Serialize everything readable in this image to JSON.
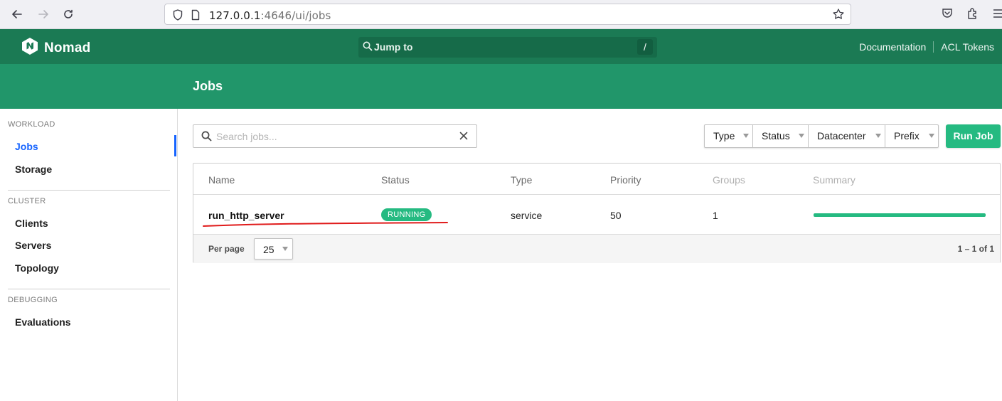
{
  "browser": {
    "url_host": "127.0.0.1",
    "url_rest": ":4646/ui/jobs"
  },
  "header": {
    "brand": "Nomad",
    "jump_to": "Jump to",
    "jump_shortcut": "/",
    "links": [
      "Documentation",
      "ACL Tokens"
    ]
  },
  "page": {
    "title": "Jobs"
  },
  "sidebar": {
    "sections": [
      {
        "heading": "WORKLOAD",
        "items": [
          "Jobs",
          "Storage"
        ]
      },
      {
        "heading": "CLUSTER",
        "items": [
          "Clients",
          "Servers",
          "Topology"
        ]
      },
      {
        "heading": "DEBUGGING",
        "items": [
          "Evaluations"
        ]
      }
    ],
    "active_item": "Jobs"
  },
  "toolbar": {
    "search_placeholder": "Search jobs...",
    "filters": [
      "Type",
      "Status",
      "Datacenter",
      "Prefix"
    ],
    "run_job": "Run Job"
  },
  "table": {
    "columns": [
      "Name",
      "Status",
      "Type",
      "Priority",
      "Groups",
      "Summary"
    ],
    "rows": [
      {
        "name": "run_http_server",
        "status": "RUNNING",
        "type": "service",
        "priority": "50",
        "groups": "1",
        "summary_fraction": 1.0
      }
    ],
    "per_page_label": "Per page",
    "per_page_value": "25",
    "pagination": "1 – 1 of 1"
  },
  "colors": {
    "header_green": "#1b7a54",
    "title_bar_green": "#21966a",
    "accent_green": "#25ba81",
    "active_blue": "#1563ff",
    "annotation_red": "#e01b1b"
  },
  "icons": [
    "back-arrow-icon",
    "forward-arrow-icon",
    "reload-icon",
    "shield-icon",
    "page-icon",
    "bookmark-star-icon",
    "pocket-icon",
    "extensions-icon",
    "menu-icon",
    "nomad-logo-icon",
    "search-icon",
    "clear-icon"
  ]
}
